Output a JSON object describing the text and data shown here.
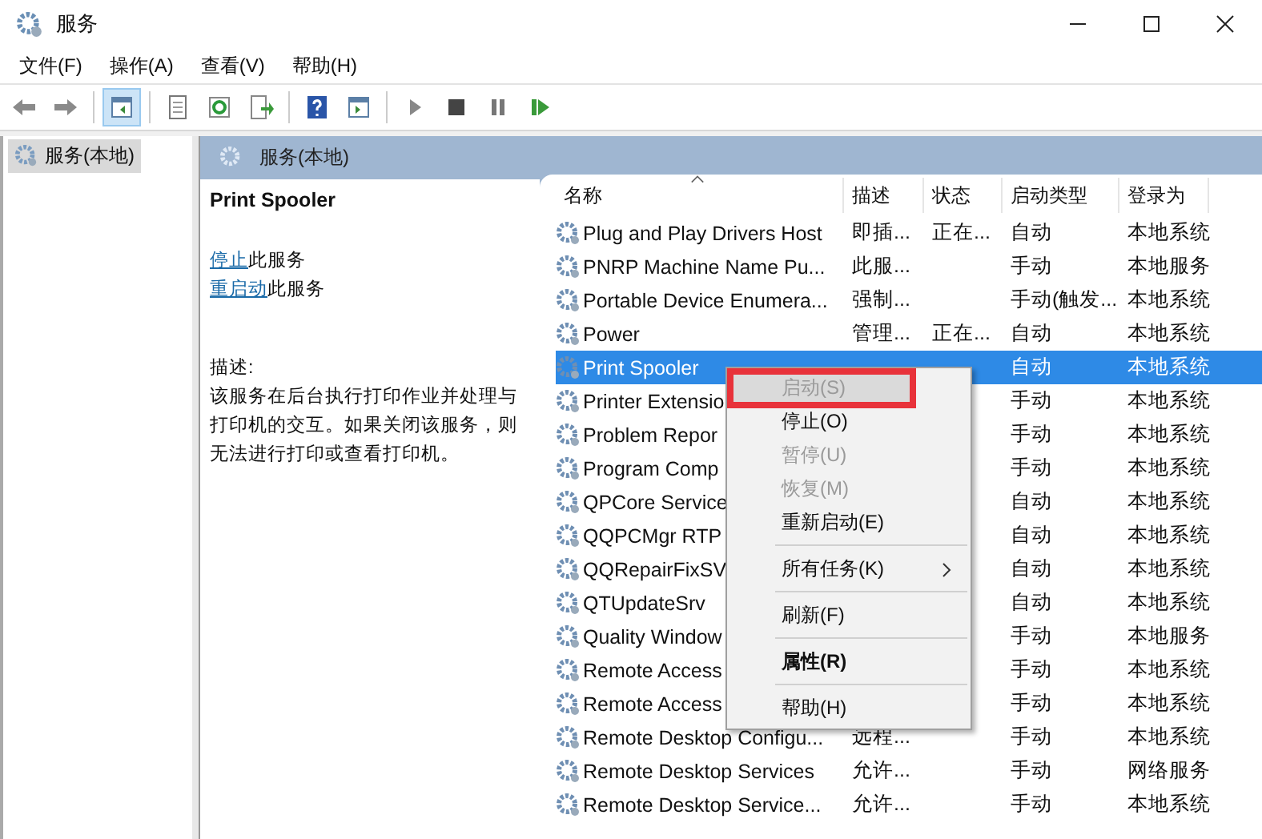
{
  "window": {
    "title": "服务"
  },
  "menu_bar": [
    "文件(F)",
    "操作(A)",
    "查看(V)",
    "帮助(H)"
  ],
  "toolbar": {
    "console_tree_selected": true
  },
  "tree": {
    "items": [
      {
        "label": "服务(本地)",
        "selected": true
      }
    ]
  },
  "pane_header": "服务(本地)",
  "detail": {
    "service_name": "Print Spooler",
    "actions": [
      {
        "link": "停止",
        "text": "此服务"
      },
      {
        "link": "重启动",
        "text": "此服务"
      }
    ],
    "description_label": "描述:",
    "description": "该服务在后台执行打印作业并处理与打印机的交互。如果关闭该服务，则无法进行打印或查看打印机。"
  },
  "table": {
    "columns": [
      "名称",
      "描述",
      "状态",
      "启动类型",
      "登录为"
    ],
    "rows": [
      {
        "name": "Plug and Play Drivers Host",
        "desc": "即插...",
        "status": "正在...",
        "startup": "自动",
        "logon": "本地系统",
        "selected": false
      },
      {
        "name": "PNRP Machine Name Pu...",
        "desc": "此服...",
        "startup": "手动",
        "logon": "本地服务",
        "selected": false
      },
      {
        "name": "Portable Device Enumera...",
        "desc": "强制...",
        "startup": "手动(触发...",
        "logon": "本地系统",
        "selected": false
      },
      {
        "name": "Power",
        "desc": "管理...",
        "status": "正在...",
        "startup": "自动",
        "logon": "本地系统",
        "selected": false
      },
      {
        "name": "Print Spooler",
        "startup": "自动",
        "logon": "本地系统",
        "selected": true
      },
      {
        "name": "Printer Extensio",
        "startup": "手动",
        "logon": "本地系统",
        "selected": false
      },
      {
        "name": "Problem Repor",
        "startup": "手动",
        "logon": "本地系统",
        "selected": false
      },
      {
        "name": "Program Comp",
        "startup": "手动",
        "logon": "本地系统",
        "selected": false
      },
      {
        "name": "QPCore Service",
        "startup": "自动",
        "logon": "本地系统",
        "selected": false
      },
      {
        "name": "QQPCMgr RTP",
        "startup": "自动",
        "logon": "本地系统",
        "selected": false
      },
      {
        "name": "QQRepairFixSV",
        "startup": "自动",
        "logon": "本地系统",
        "selected": false
      },
      {
        "name": "QTUpdateSrv",
        "startup": "自动",
        "logon": "本地系统",
        "selected": false
      },
      {
        "name": "Quality Window",
        "startup": "手动",
        "logon": "本地服务",
        "selected": false
      },
      {
        "name": "Remote Access",
        "startup": "手动",
        "logon": "本地系统",
        "selected": false
      },
      {
        "name": "Remote Access",
        "startup": "手动",
        "logon": "本地系统",
        "selected": false
      },
      {
        "name": "Remote Desktop Configu...",
        "desc": "远程...",
        "startup": "手动",
        "logon": "本地系统",
        "selected": false
      },
      {
        "name": "Remote Desktop Services",
        "desc": "允许...",
        "startup": "手动",
        "logon": "网络服务",
        "selected": false
      },
      {
        "name": "Remote Desktop Service...",
        "desc": "允许...",
        "startup": "手动",
        "logon": "本地系统",
        "selected": false
      }
    ]
  },
  "context_menu": [
    {
      "kind": "item",
      "label": "启动(S)",
      "disabled": true,
      "bold": false,
      "submenu": false,
      "highlighted": true
    },
    {
      "kind": "item",
      "label": "停止(O)",
      "disabled": false,
      "bold": false,
      "submenu": false,
      "highlighted": false
    },
    {
      "kind": "item",
      "label": "暂停(U)",
      "disabled": true,
      "bold": false,
      "submenu": false,
      "highlighted": false
    },
    {
      "kind": "item",
      "label": "恢复(M)",
      "disabled": true,
      "bold": false,
      "submenu": false,
      "highlighted": false
    },
    {
      "kind": "item",
      "label": "重新启动(E)",
      "disabled": false,
      "bold": false,
      "submenu": false,
      "highlighted": false
    },
    {
      "kind": "separator"
    },
    {
      "kind": "item",
      "label": "所有任务(K)",
      "disabled": false,
      "bold": false,
      "submenu": true,
      "highlighted": false
    },
    {
      "kind": "separator"
    },
    {
      "kind": "item",
      "label": "刷新(F)",
      "disabled": false,
      "bold": false,
      "submenu": false,
      "highlighted": false
    },
    {
      "kind": "separator"
    },
    {
      "kind": "item",
      "label": "属性(R)",
      "disabled": false,
      "bold": true,
      "submenu": false,
      "highlighted": false
    },
    {
      "kind": "separator"
    },
    {
      "kind": "item",
      "label": "帮助(H)",
      "disabled": false,
      "bold": false,
      "submenu": false,
      "highlighted": false
    }
  ]
}
